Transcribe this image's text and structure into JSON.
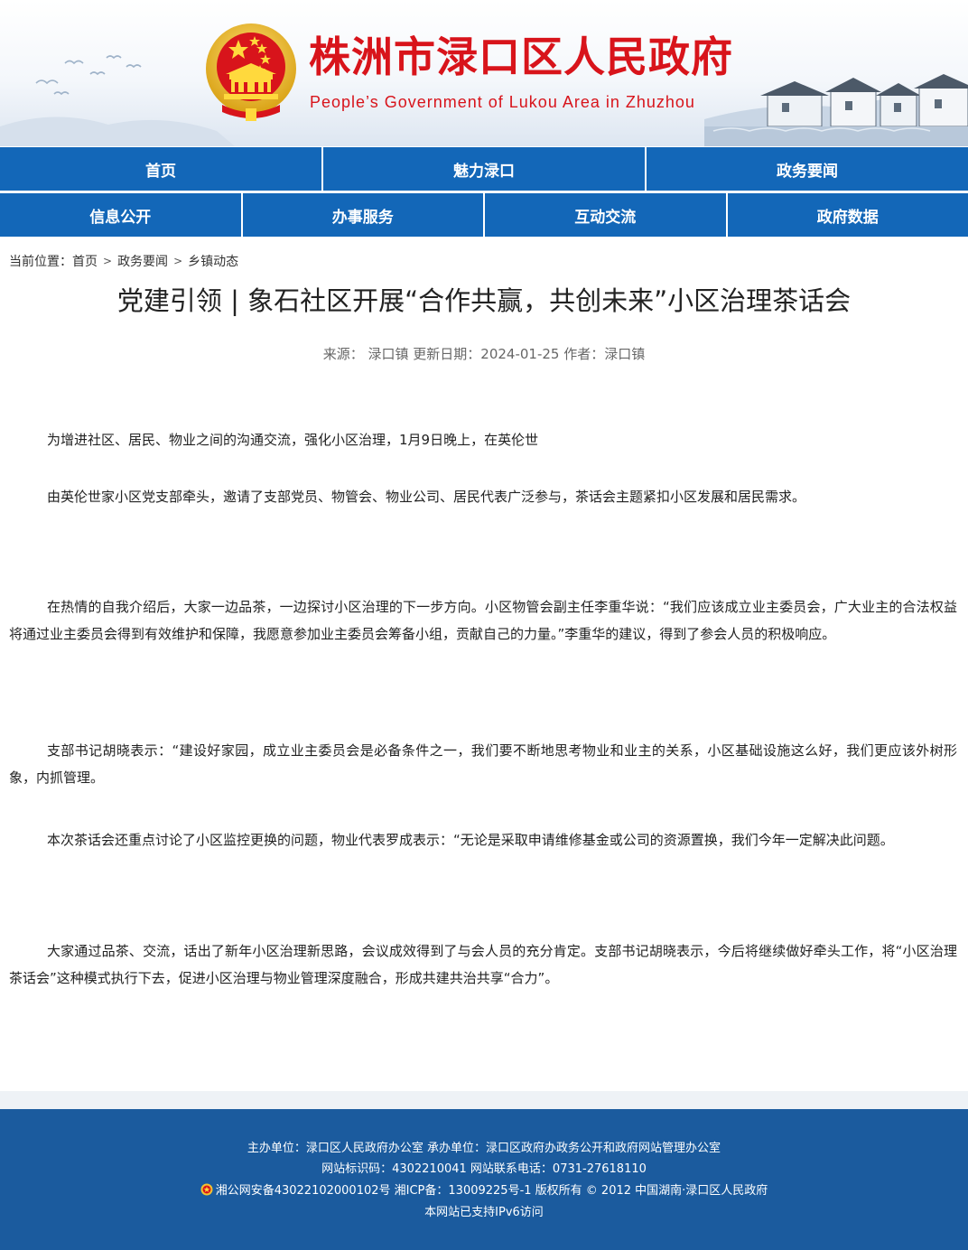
{
  "header": {
    "title": "株洲市渌口区人民政府",
    "subtitle": "People’s Government of Lukou Area in Zhuzhou"
  },
  "nav": {
    "row1": [
      "首页",
      "魅力渌口",
      "政务要闻"
    ],
    "row2": [
      "信息公开",
      "办事服务",
      "互动交流",
      "政府数据"
    ]
  },
  "breadcrumb": {
    "label": "当前位置：",
    "items": [
      "首页",
      "政务要闻",
      "乡镇动态"
    ],
    "separator": ">"
  },
  "article": {
    "title": "党建引领 | 象石社区开展“合作共赢，共创未来”小区治理茶话会",
    "meta": "来源： 渌口镇 更新日期：2024-01-25 作者：渌口镇",
    "paragraphs": [
      "为增进社区、居民、物业之间的沟通交流，强化小区治理，1月9日晚上，在英伦世",
      "由英伦世家小区党支部牵头，邀请了支部党员、物管会、物业公司、居民代表广泛参与，茶话会主题紧扣小区发展和居民需求。",
      "在热情的自我介绍后，大家一边品茶，一边探讨小区治理的下一步方向。小区物管会副主任李重华说：“我们应该成立业主委员会，广大业主的合法权益将通过业主委员会得到有效维护和保障，我愿意参加业主委员会筹备小组，贡献自己的力量。”李重华的建议，得到了参会人员的积极响应。",
      "支部书记胡晓表示：“建设好家园，成立业主委员会是必备条件之一，我们要不断地思考物业和业主的关系，小区基础设施这么好，我们更应该外树形象，内抓管理。",
      "本次茶话会还重点讨论了小区监控更换的问题，物业代表罗成表示：“无论是采取申请维修基金或公司的资源置换，我们今年一定解决此问题。",
      "大家通过品茶、交流，话出了新年小区治理新思路，会议成效得到了与会人员的充分肯定。支部书记胡晓表示，今后将继续做好牵头工作，将“小区治理茶话会”这种模式执行下去，促进小区治理与物业管理深度融合，形成共建共治共享“合力”。"
    ]
  },
  "footer": {
    "line1": "主办单位：渌口区人民政府办公室 承办单位：渌口区政府办政务公开和政府网站管理办公室",
    "line2": "网站标识码：4302210041 网站联系电话：0731-27618110",
    "line3": "湘公网安备43022102000102号 湘ICP备：13009225号-1 版权所有 © 2012 中国湖南·渌口区人民政府",
    "line4": "本网站已支持IPv6访问"
  },
  "colors": {
    "brand_red": "#d8141b",
    "nav_blue": "#1367b8",
    "footer_blue": "#1b5b9e"
  },
  "icons": [
    "national-emblem-icon",
    "police-badge-icon"
  ]
}
